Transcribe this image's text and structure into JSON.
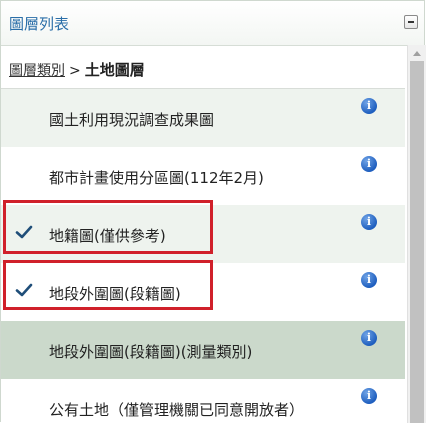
{
  "panel": {
    "title": "圖層列表"
  },
  "breadcrumb": {
    "parent": "圖層類別",
    "separator": ">",
    "current": "土地圖層"
  },
  "layers": [
    {
      "label": "國土利用現況調查成果圖",
      "checked": false
    },
    {
      "label": "都市計畫使用分區圖(112年2月)",
      "checked": false
    },
    {
      "label": "地籍圖(僅供參考)",
      "checked": true
    },
    {
      "label": "地段外圍圖(段籍圖)",
      "checked": true
    },
    {
      "label": "地段外圍圖(段籍圖)(測量類別)",
      "checked": false
    },
    {
      "label": "公有土地（僅管理機關已同意開放者）",
      "checked": false
    }
  ],
  "info_glyph": "i",
  "colors": {
    "title": "#2a6ea8",
    "check": "#1f4e79",
    "highlight": "#d0202a",
    "info": "#1f5fbf",
    "row_alt": "#eef3ee",
    "row_selected": "#cbd9cb"
  }
}
